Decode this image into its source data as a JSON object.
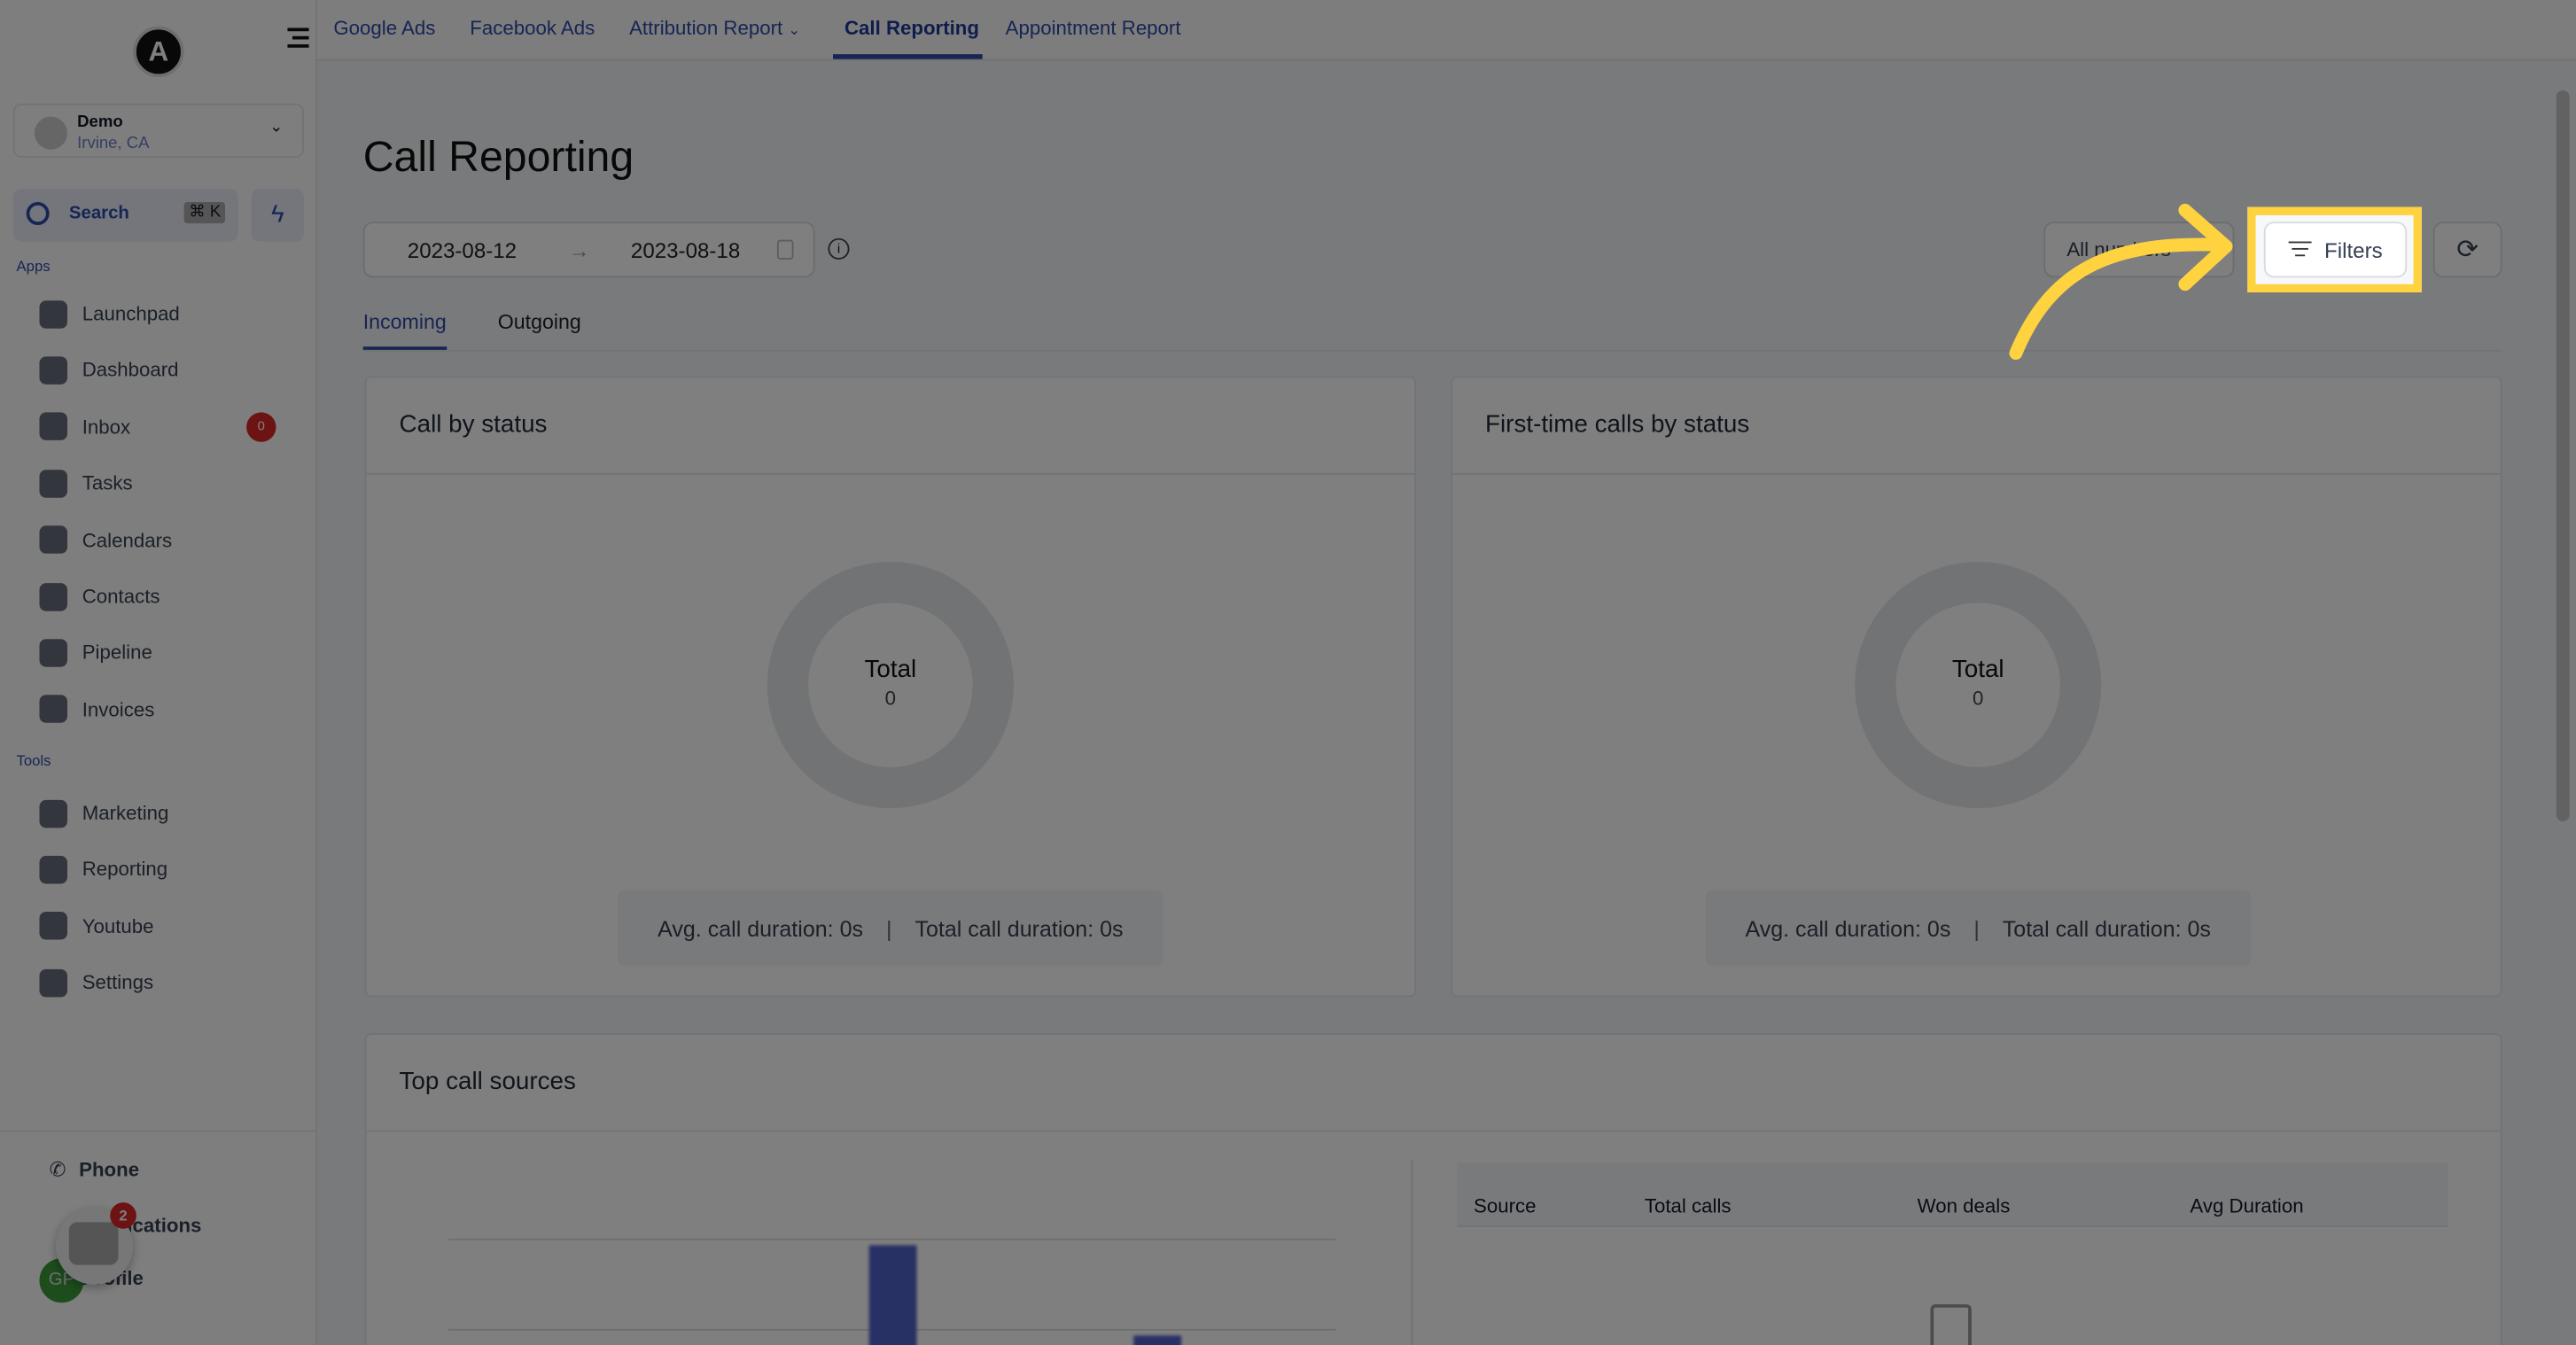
{
  "topnav": {
    "tabs": [
      {
        "label": "Google Ads"
      },
      {
        "label": "Facebook Ads"
      },
      {
        "label": "Attribution Report"
      },
      {
        "label": "Call Reporting",
        "active": true
      },
      {
        "label": "Appointment Report"
      }
    ]
  },
  "sidebar": {
    "logo_letter": "A",
    "location": {
      "name": "Demo",
      "address": "Irvine, CA"
    },
    "search": {
      "label": "Search",
      "shortcut": "⌘ K"
    },
    "apps_label": "Apps",
    "apps": [
      {
        "label": "Launchpad",
        "icon": "rocket-icon"
      },
      {
        "label": "Dashboard",
        "icon": "grid-icon"
      },
      {
        "label": "Inbox",
        "icon": "inbox-icon",
        "badge": "0"
      },
      {
        "label": "Tasks",
        "icon": "clipboard-icon"
      },
      {
        "label": "Calendars",
        "icon": "calendar-icon"
      },
      {
        "label": "Contacts",
        "icon": "person-icon"
      },
      {
        "label": "Pipeline",
        "icon": "funnel-icon"
      },
      {
        "label": "Invoices",
        "icon": "invoice-icon"
      }
    ],
    "tools_label": "Tools",
    "tools": [
      {
        "label": "Marketing",
        "icon": "megaphone-icon"
      },
      {
        "label": "Reporting",
        "icon": "pie-chart-icon"
      },
      {
        "label": "Youtube",
        "icon": "youtube-icon"
      },
      {
        "label": "Settings",
        "icon": "gear-icon"
      }
    ],
    "bottom": [
      {
        "label": "Phone"
      },
      {
        "label": "Notifications"
      },
      {
        "label": "Profile"
      }
    ],
    "avatar_initials": "GP",
    "chat_badge": "2"
  },
  "page": {
    "title": "Call Reporting",
    "date_start": "2023-08-12",
    "date_end": "2023-08-18",
    "numbers_select": "All numbers",
    "filters_label": "Filters",
    "tabs": [
      {
        "label": "Incoming",
        "active": true
      },
      {
        "label": "Outgoing"
      }
    ]
  },
  "cards": [
    {
      "title": "Call by status",
      "total_label": "Total",
      "total": "0",
      "avg": "Avg. call duration: 0s",
      "total_duration": "Total call duration: 0s"
    },
    {
      "title": "First-time calls by status",
      "total_label": "Total",
      "total": "0",
      "avg": "Avg. call duration: 0s",
      "total_duration": "Total call duration: 0s"
    }
  ],
  "sources": {
    "title": "Top call sources",
    "columns": [
      "Source",
      "Total calls",
      "Won deals",
      "Avg Duration"
    ]
  },
  "colors": {
    "accent": "#2f4aa8",
    "highlight": "#ffd23f",
    "badge": "#dc2626"
  }
}
